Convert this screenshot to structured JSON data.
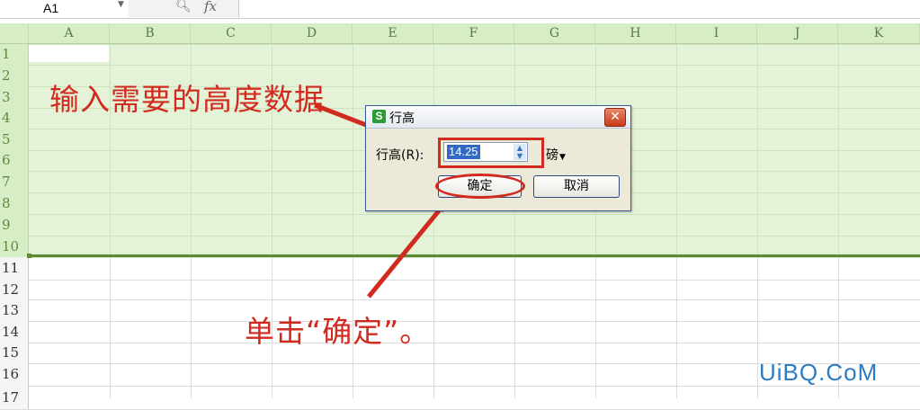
{
  "formula_bar": {
    "cell_ref": "A1",
    "dropdown_icon": "chevron-down-icon",
    "zoom_icon": "zoom-icon",
    "fx_label": "fx"
  },
  "columns": [
    "A",
    "B",
    "C",
    "D",
    "E",
    "F",
    "G",
    "H",
    "I",
    "J",
    "K"
  ],
  "rows": [
    "1",
    "2",
    "3",
    "4",
    "5",
    "6",
    "7",
    "8",
    "9",
    "10",
    "11",
    "12",
    "13",
    "14",
    "15",
    "16",
    "17"
  ],
  "selected_rows_count": 10,
  "colors": {
    "selection": "#e4f3d8",
    "header": "#d7edc6",
    "annotation": "#d12a1e",
    "watermark": "#2a7dc4"
  },
  "dialog": {
    "title": "行高",
    "app_icon": "S",
    "row_height_label": "行高(R):",
    "row_height_value": "14.25",
    "unit": "磅",
    "ok_label": "确定",
    "cancel_label": "取消",
    "close_label": "✕"
  },
  "annotations": {
    "input_hint": "输入需要的高度数据",
    "ok_hint": "单击“确定”。"
  },
  "watermark": "UiBQ.CoM"
}
